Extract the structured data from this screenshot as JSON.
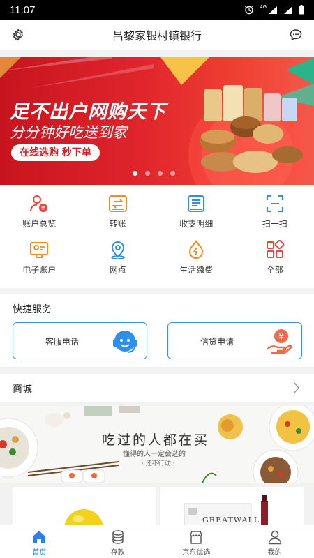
{
  "status_bar": {
    "time": "11:07",
    "network": "4G"
  },
  "header": {
    "title": "昌黎家银村镇银行",
    "left_icon": "gear-icon",
    "right_icon": "chat-bubble-icon"
  },
  "banner": {
    "headline": "足不出户网购天下",
    "subline": "分分钟好吃送到家",
    "pill": "在线选购 秒下单",
    "slide_count": 4,
    "active_slide": 1
  },
  "menu": [
    {
      "label": "账户总览",
      "icon": "account-overview-icon",
      "color": "#e8453c"
    },
    {
      "label": "转账",
      "icon": "transfer-icon",
      "color": "#f28a1e"
    },
    {
      "label": "收支明细",
      "icon": "statement-icon",
      "color": "#2d8ff0"
    },
    {
      "label": "扫一扫",
      "icon": "scan-icon",
      "color": "#2d8ff0"
    },
    {
      "label": "电子账户",
      "icon": "e-account-icon",
      "color": "#f28a1e"
    },
    {
      "label": "网点",
      "icon": "branch-location-icon",
      "color": "#2d8ff0"
    },
    {
      "label": "生活缴费",
      "icon": "utility-payment-icon",
      "color": "#f28a1e"
    },
    {
      "label": "全部",
      "icon": "all-apps-icon",
      "color": "#e8453c"
    }
  ],
  "quick_services": {
    "title": "快捷服务",
    "items": [
      {
        "label": "客服电话",
        "icon": "customer-service-headset-icon"
      },
      {
        "label": "信贷申请",
        "icon": "loan-application-icon"
      }
    ]
  },
  "mall": {
    "title": "商城",
    "banner_line1": "吃过的人都在买",
    "banner_line2": "懂得的人一定会选的",
    "banner_line3": "· 还不行动 ·",
    "product2_brand": "GREATWALL"
  },
  "bottom_nav": [
    {
      "label": "首页",
      "icon": "home-icon",
      "active": true
    },
    {
      "label": "存款",
      "icon": "deposit-coins-icon",
      "active": false
    },
    {
      "label": "京东优选",
      "icon": "shop-icon",
      "active": false
    },
    {
      "label": "我的",
      "icon": "profile-icon",
      "active": false
    }
  ],
  "colors": {
    "accent_blue": "#2d7ff0",
    "banner_red": "#d8202a",
    "orange": "#f28a1e",
    "red": "#e8453c"
  }
}
